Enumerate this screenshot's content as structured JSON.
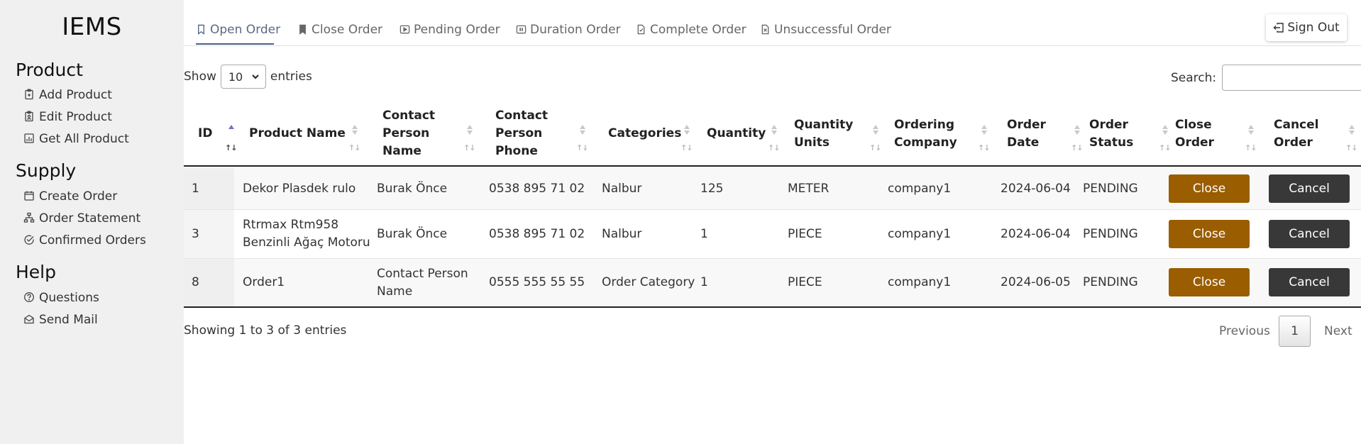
{
  "app": {
    "brand": "IEMS"
  },
  "sidebar": {
    "sections": [
      {
        "title": "Product",
        "items": [
          {
            "label": "Add Product",
            "icon": "clipboard-plus-icon"
          },
          {
            "label": "Edit Product",
            "icon": "clipboard-edit-icon"
          },
          {
            "label": "Get All Product",
            "icon": "bar-chart-icon"
          }
        ]
      },
      {
        "title": "Supply",
        "items": [
          {
            "label": "Create Order",
            "icon": "calendar-icon"
          },
          {
            "label": "Order Statement",
            "icon": "diagram-icon"
          },
          {
            "label": "Confirmed Orders",
            "icon": "check-circle-icon"
          }
        ]
      },
      {
        "title": "Help",
        "items": [
          {
            "label": "Questions",
            "icon": "question-circle-icon"
          },
          {
            "label": "Send Mail",
            "icon": "envelope-icon"
          }
        ]
      }
    ]
  },
  "tabs": [
    {
      "label": "Open Order",
      "icon": "bookmark-icon",
      "active": true
    },
    {
      "label": "Close Order",
      "icon": "bookmark-fill-icon"
    },
    {
      "label": "Pending Order",
      "icon": "play-icon"
    },
    {
      "label": "Duration Order",
      "icon": "pause-icon"
    },
    {
      "label": "Complete Order",
      "icon": "file-check-icon"
    },
    {
      "label": "Unsuccessful Order",
      "icon": "file-x-icon"
    }
  ],
  "header": {
    "signout_label": "Sign Out"
  },
  "controls": {
    "show_label": "Show",
    "entries_value": "10",
    "entries_label": "entries",
    "search_label": "Search:",
    "search_value": ""
  },
  "table": {
    "columns": [
      {
        "label": "ID",
        "sorted": "asc"
      },
      {
        "label": "Product Name"
      },
      {
        "label": "Contact Person Name"
      },
      {
        "label": "Contact Person Phone"
      },
      {
        "label": "Categories"
      },
      {
        "label": "Quantity"
      },
      {
        "label": "Quantity Units"
      },
      {
        "label": "Ordering Company"
      },
      {
        "label": "Order Date"
      },
      {
        "label": "Order Status"
      },
      {
        "label": "Close Order"
      },
      {
        "label": "Cancel Order"
      }
    ],
    "sort_arrows": "↑↓",
    "rows": [
      {
        "id": "1",
        "product": "Dekor Plasdek rulo",
        "contact": "Burak Önce",
        "phone": "0538 895 71 02",
        "category": "Nalbur",
        "quantity": "125",
        "unit": "METER",
        "company": "company1",
        "date": "2024-06-04",
        "status": "PENDING",
        "close_label": "Close",
        "cancel_label": "Cancel"
      },
      {
        "id": "3",
        "product": "Rtrmax Rtm958 Benzinli Ağaç Motoru",
        "contact": "Burak Önce",
        "phone": "0538 895 71 02",
        "category": "Nalbur",
        "quantity": "1",
        "unit": "PIECE",
        "company": "company1",
        "date": "2024-06-04",
        "status": "PENDING",
        "close_label": "Close",
        "cancel_label": "Cancel"
      },
      {
        "id": "8",
        "product": "Order1",
        "contact": "Contact Person Name",
        "phone": "0555 555 55 55",
        "category": "Order Category",
        "quantity": "1",
        "unit": "PIECE",
        "company": "company1",
        "date": "2024-06-05",
        "status": "PENDING",
        "close_label": "Close",
        "cancel_label": "Cancel"
      }
    ]
  },
  "footer": {
    "info": "Showing 1 to 3 of 3 entries",
    "previous_label": "Previous",
    "page": "1",
    "next_label": "Next"
  },
  "colors": {
    "close_button": "#9a5d00",
    "cancel_button": "#383838",
    "sidebar_bg": "#f0f0f0",
    "active_tab": "#4d6286"
  }
}
